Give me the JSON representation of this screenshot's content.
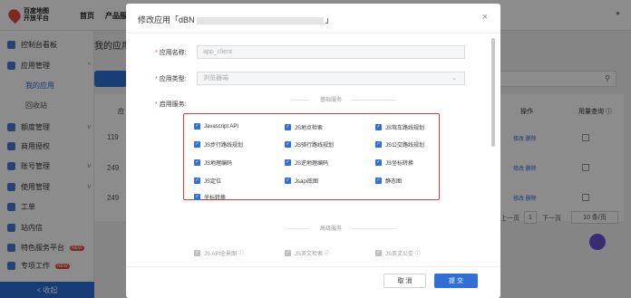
{
  "brand": {
    "line1": "百度地图",
    "line2": "开放平台"
  },
  "topnav": [
    {
      "label": "首页"
    },
    {
      "label": "产品服"
    }
  ],
  "sidebar": {
    "items": [
      {
        "label": "控制台看板"
      },
      {
        "label": "应用管理",
        "chevron": "^"
      },
      {
        "label": "额度管理",
        "chevron": "v"
      },
      {
        "label": "商用授权"
      },
      {
        "label": "账号管理",
        "chevron": "v"
      },
      {
        "label": "使用管理",
        "chevron": "v"
      },
      {
        "label": "工单"
      },
      {
        "label": "站内信"
      },
      {
        "label": "特色服务平台",
        "chevron": "v",
        "badge": "NEW"
      },
      {
        "label": "专项工作",
        "badge": "NEW"
      }
    ],
    "subs": [
      {
        "label": "我的应用"
      },
      {
        "label": "回收站"
      }
    ],
    "collapse": "< 收起"
  },
  "main": {
    "title": "我的应用"
  },
  "table": {
    "headers": [
      "应",
      "操作",
      "用量查询 ⓘ"
    ],
    "rows": [
      {
        "num": "119",
        "ops": "修改  删除"
      },
      {
        "num": "249",
        "ops": "修改  删除"
      },
      {
        "num": "249",
        "ops": "修改  删除"
      }
    ],
    "pager": {
      "prev": "上一页",
      "page": "1",
      "next": "下一页",
      "size": "10 条/页"
    }
  },
  "modal": {
    "title": "修改应用「dBN",
    "title_end": "」",
    "close": "×",
    "app_name_label": "应用名称:",
    "app_name_value": "app_client",
    "app_type_label": "应用类型:",
    "app_type_value": "浏览器端",
    "services_label": "启用服务:",
    "basic_section": "基础服务",
    "premium_section": "高级服务",
    "services": [
      {
        "label": "Javascript API"
      },
      {
        "label": "JS地点检索"
      },
      {
        "label": "JS驾车路线规划"
      },
      {
        "label": "JS步行路线规划"
      },
      {
        "label": "JS骑行路线规划"
      },
      {
        "label": "JS公交路线规划"
      },
      {
        "label": "JS地理编码"
      },
      {
        "label": "JS逆地理编码"
      },
      {
        "label": "JS坐标转换"
      },
      {
        "label": "JS定位"
      },
      {
        "label": "Jsapi底图"
      },
      {
        "label": "静态图"
      },
      {
        "label": "坐标转换"
      }
    ],
    "premium_services": [
      {
        "label": "JS API全景图 ⓘ"
      },
      {
        "label": "JS英文检索 ⓘ"
      },
      {
        "label": "JS英文公交 ⓘ"
      }
    ],
    "cancel": "取 消",
    "submit": "提 交"
  },
  "colors": {
    "accent": "#2f6fd6",
    "highlight": "#e03a30"
  }
}
